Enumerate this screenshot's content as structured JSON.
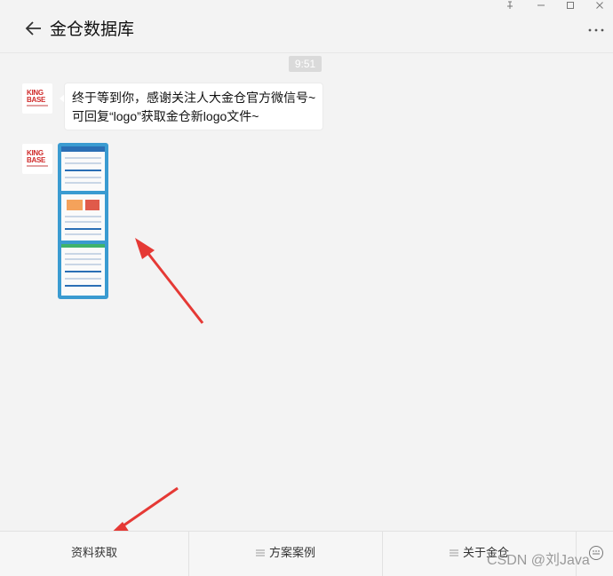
{
  "window": {
    "title": "金仓数据库",
    "controls": [
      "pin-icon",
      "minimize-icon",
      "maximize-icon",
      "close-icon"
    ]
  },
  "chat": {
    "time": "9:51",
    "messages": [
      {
        "type": "text",
        "sender_avatar": "kingbase-logo",
        "lines": [
          "终于等到你，感谢关注人大金仓官方微信号~",
          "可回复“logo”获取金仓新logo文件~"
        ]
      },
      {
        "type": "image",
        "sender_avatar": "kingbase-logo"
      }
    ]
  },
  "avatar": {
    "line1": "KING",
    "line2": "BASE"
  },
  "menu": [
    {
      "label": "资料获取",
      "has_icon": false
    },
    {
      "label": "方案案例",
      "has_icon": true
    },
    {
      "label": "关于金仓",
      "has_icon": true
    }
  ],
  "watermark": "CSDN @刘Java",
  "colors": {
    "background": "#f3f3f3",
    "annotation_arrow": "#e53935",
    "brand_red": "#d02a2a"
  }
}
